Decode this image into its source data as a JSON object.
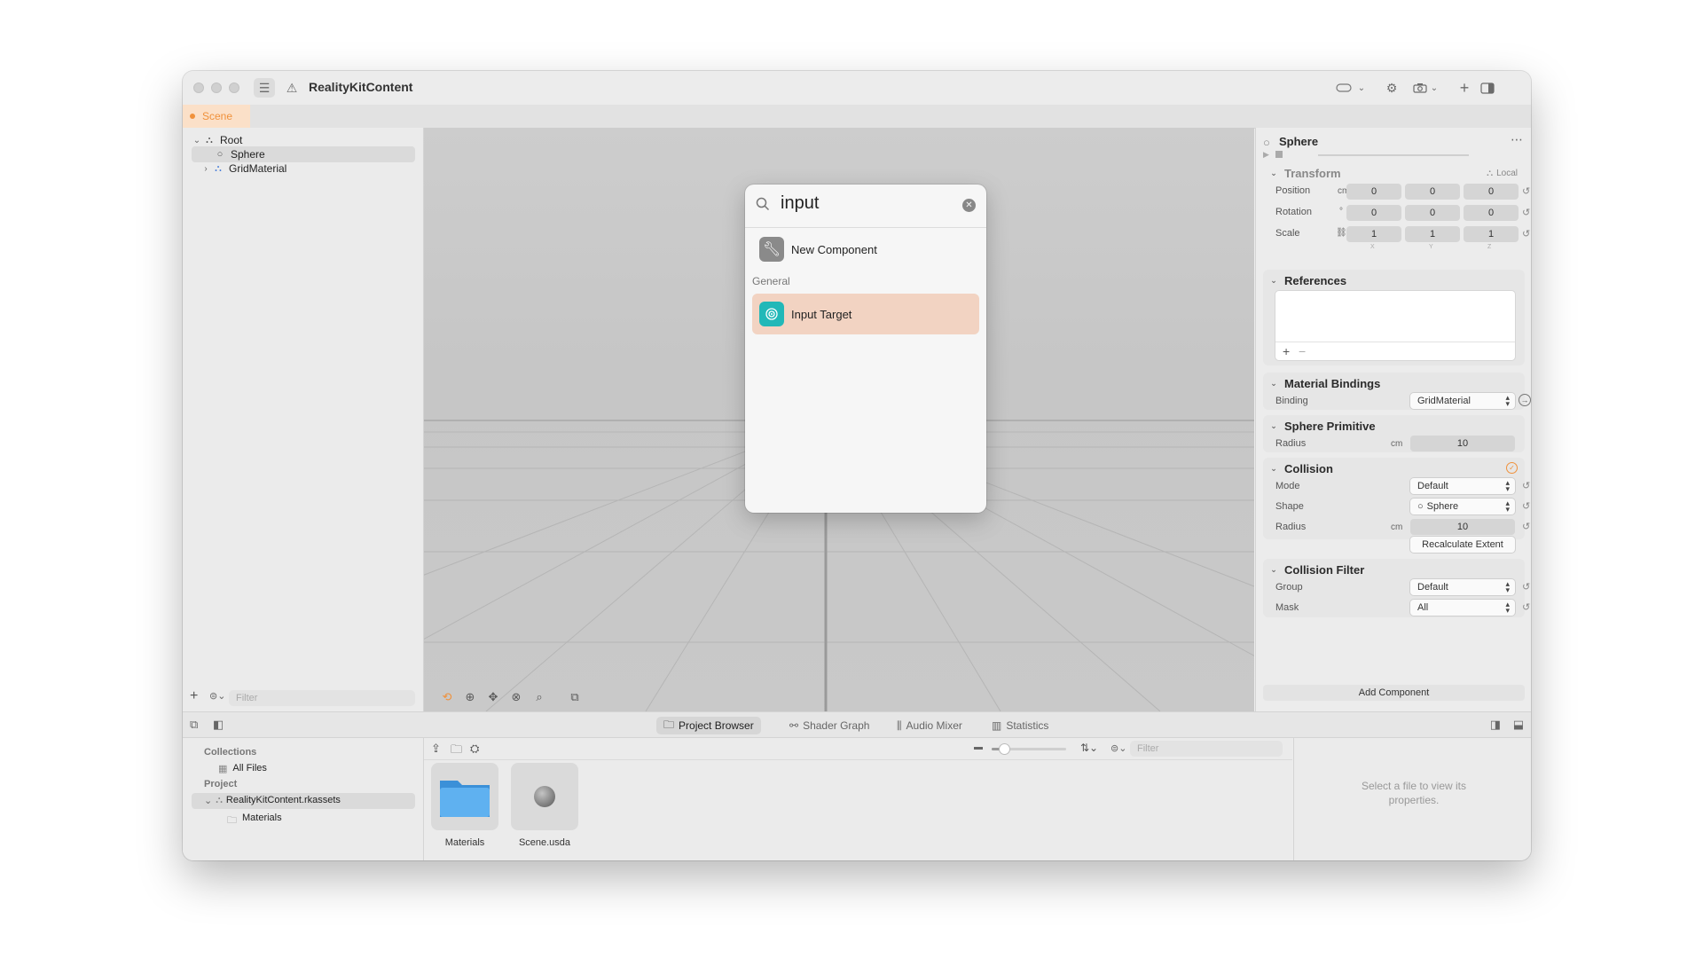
{
  "window": {
    "title": "RealityKitContent"
  },
  "tabs": [
    {
      "label": "Scene",
      "active": true
    }
  ],
  "outline": {
    "items": [
      {
        "label": "Root",
        "icon": "node-icon",
        "expanded": true
      },
      {
        "label": "Sphere",
        "icon": "sphere-icon",
        "selected": true
      },
      {
        "label": "GridMaterial",
        "icon": "material-icon",
        "expanded": false
      }
    ],
    "filter_placeholder": "Filter"
  },
  "popup": {
    "query": "input",
    "new_component_label": "New Component",
    "section_label": "General",
    "result_label": "Input Target"
  },
  "inspector": {
    "entity_name": "Sphere",
    "transform": {
      "title": "Transform",
      "space_label": "Local",
      "position": {
        "label": "Position",
        "unit": "cm",
        "values": [
          "0",
          "0",
          "0"
        ]
      },
      "rotation": {
        "label": "Rotation",
        "unit": "°",
        "values": [
          "0",
          "0",
          "0"
        ]
      },
      "scale": {
        "label": "Scale",
        "values": [
          "1",
          "1",
          "1"
        ]
      },
      "axes": [
        "X",
        "Y",
        "Z"
      ]
    },
    "references": {
      "title": "References"
    },
    "material_bindings": {
      "title": "Material Bindings",
      "binding_label": "Binding",
      "binding_value": "GridMaterial"
    },
    "sphere_primitive": {
      "title": "Sphere Primitive",
      "radius_label": "Radius",
      "radius_unit": "cm",
      "radius_value": "10"
    },
    "collision": {
      "title": "Collision",
      "mode_label": "Mode",
      "mode_value": "Default",
      "shape_label": "Shape",
      "shape_value": "Sphere",
      "radius_label": "Radius",
      "radius_unit": "cm",
      "radius_value": "10",
      "recalc_label": "Recalculate Extent"
    },
    "collision_filter": {
      "title": "Collision Filter",
      "group_label": "Group",
      "group_value": "Default",
      "mask_label": "Mask",
      "mask_value": "All"
    },
    "add_component_label": "Add Component"
  },
  "bottom_tabs": [
    {
      "label": "Project Browser",
      "icon": "folder-icon",
      "active": true
    },
    {
      "label": "Shader Graph",
      "icon": "graph-icon"
    },
    {
      "label": "Audio Mixer",
      "icon": "mixer-icon"
    },
    {
      "label": "Statistics",
      "icon": "stats-icon"
    }
  ],
  "collections": {
    "collections_header": "Collections",
    "all_files": "All Files",
    "project_header": "Project",
    "project_package": "RealityKitContent.rkassets",
    "materials_folder": "Materials"
  },
  "browser": {
    "filter_placeholder": "Filter",
    "assets": [
      {
        "name": "Materials",
        "kind": "folder"
      },
      {
        "name": "Scene.usda",
        "kind": "usd"
      }
    ]
  },
  "details": {
    "empty_message": "Select a file to view its properties."
  },
  "colors": {
    "accent": "#f0913b",
    "highlight": "#f2d3c2",
    "teal": "#21b8b8",
    "folder": "#4ba3e8"
  }
}
